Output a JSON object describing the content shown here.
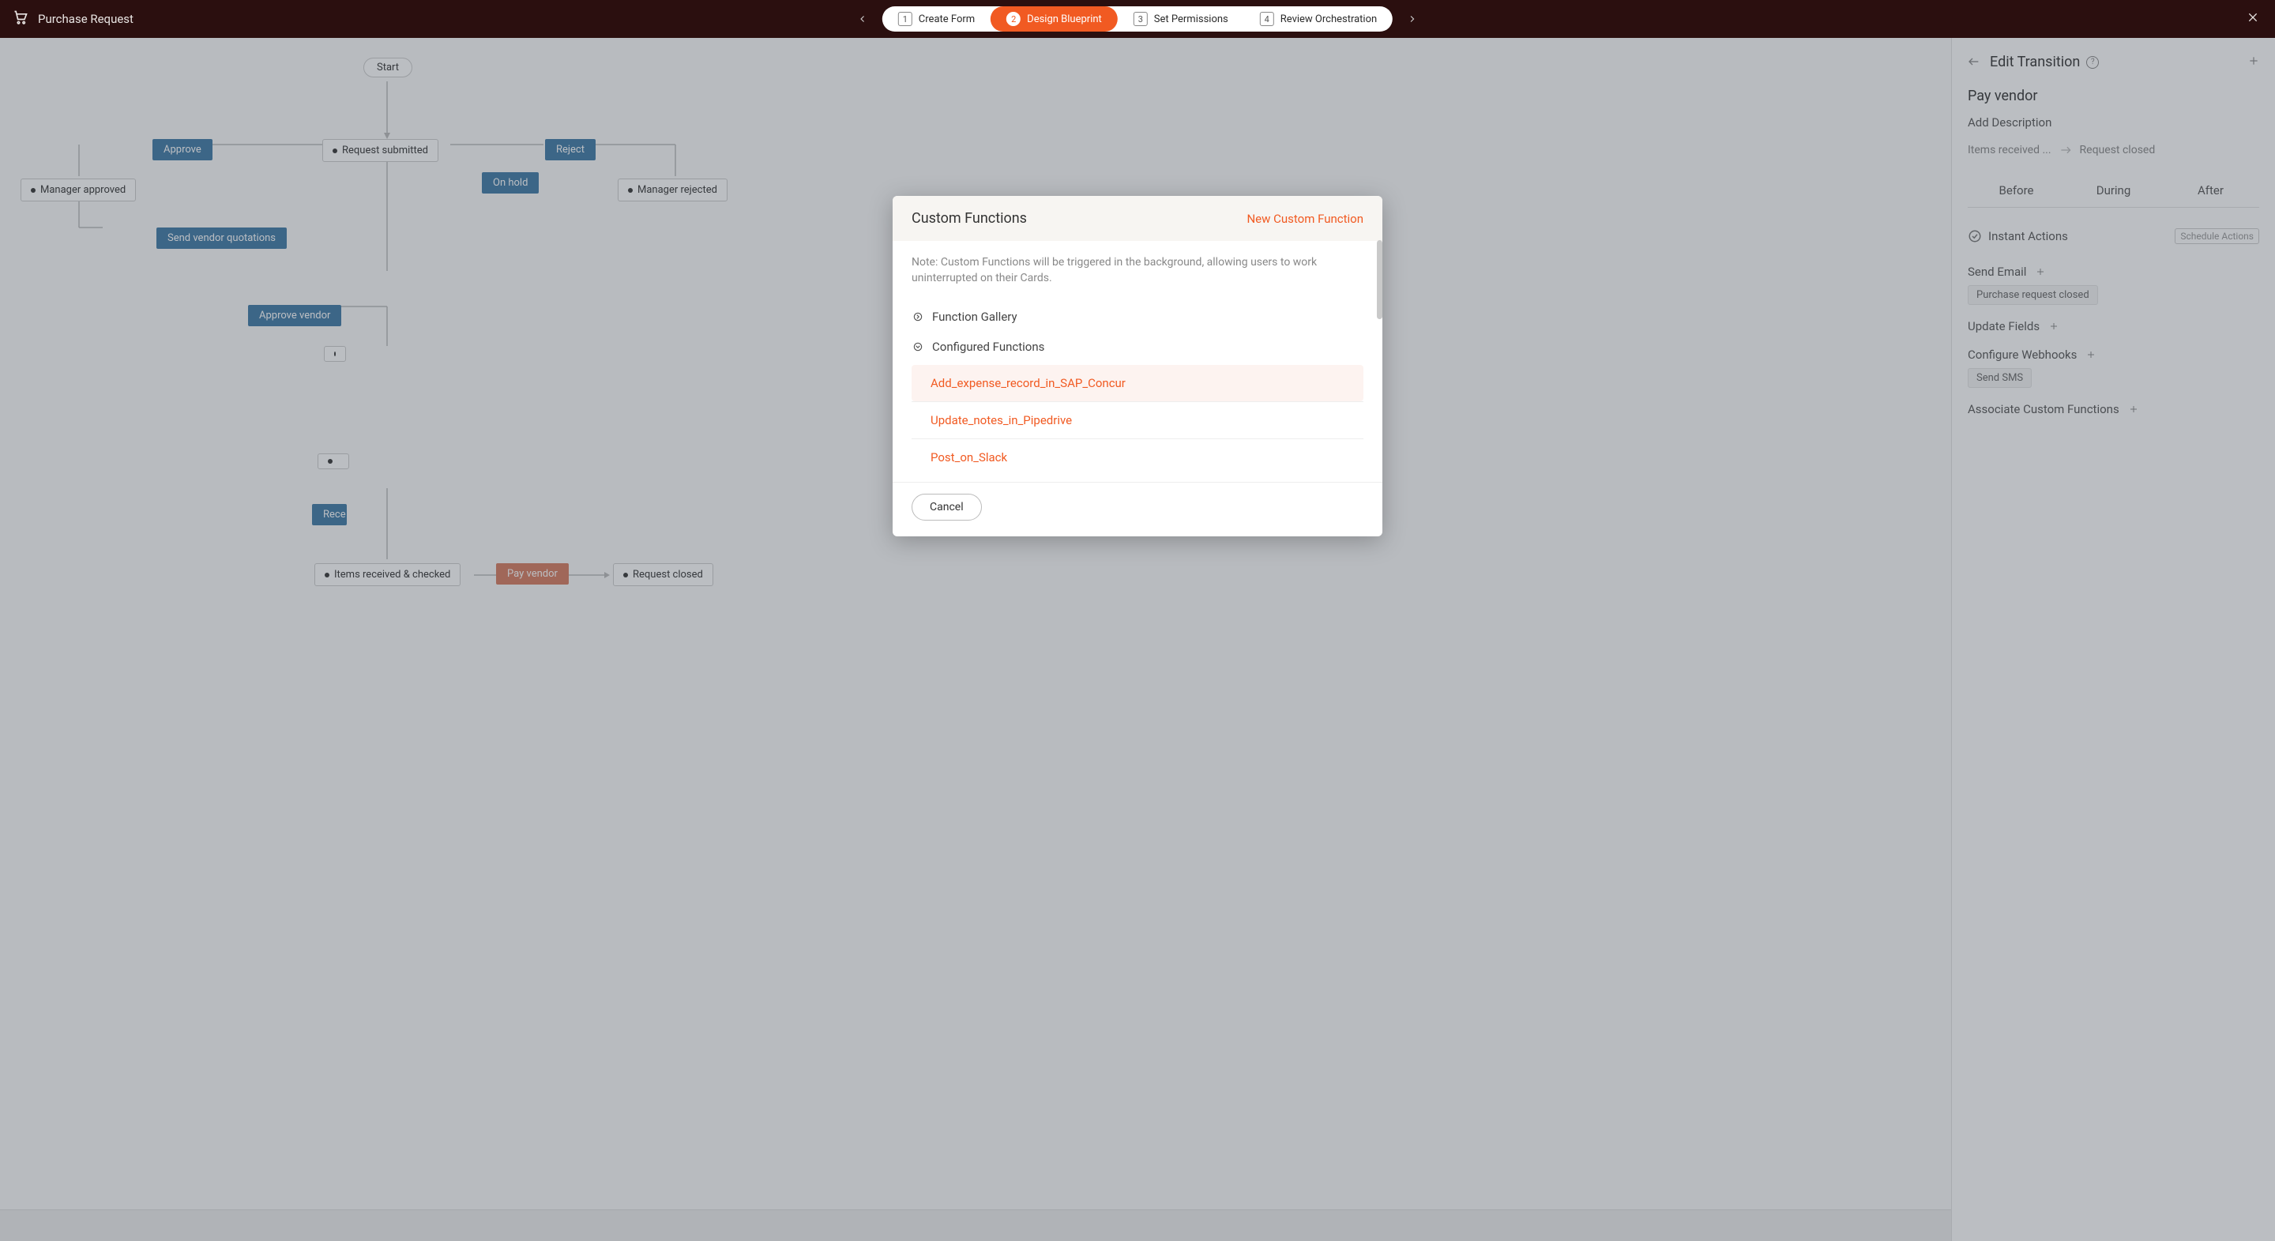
{
  "header": {
    "title": "Purchase Request",
    "steps": [
      {
        "num": "1",
        "label": "Create Form"
      },
      {
        "num": "2",
        "label": "Design Blueprint"
      },
      {
        "num": "3",
        "label": "Set Permissions"
      },
      {
        "num": "4",
        "label": "Review Orchestration"
      }
    ]
  },
  "blueprint": {
    "start": "Start",
    "stages": {
      "request_submitted": "Request submitted",
      "manager_approved": "Manager approved",
      "manager_rejected": "Manager rejected",
      "items_received_checked": "Items received & checked",
      "request_closed": "Request closed"
    },
    "transitions": {
      "approve": "Approve",
      "reject": "Reject",
      "on_hold": "On hold",
      "send_vendor_quotations": "Send vendor quotations",
      "approve_vendor": "Approve vendor",
      "receive": "Rece",
      "pay_vendor": "Pay vendor"
    }
  },
  "panel": {
    "header": "Edit Transition",
    "transition_name": "Pay vendor",
    "add_description": "Add Description",
    "from_stage": "Items received ...",
    "to_stage": "Request closed",
    "tabs": [
      "Before",
      "During",
      "After"
    ],
    "instant_actions": "Instant Actions",
    "schedule_actions": "Schedule Actions",
    "send_email": "Send Email",
    "send_email_chip": "Purchase request closed",
    "update_fields": "Update Fields",
    "configure_webhooks": "Configure Webhooks",
    "webhook_chip": "Send SMS",
    "associate_fn": "Associate Custom Functions"
  },
  "modal": {
    "title": "Custom Functions",
    "new_label": "New Custom Function",
    "note": "Note: Custom Functions will be triggered in the background, allowing users to work uninterrupted on their Cards.",
    "gallery_label": "Function Gallery",
    "configured_label": "Configured Functions",
    "functions": [
      "Add_expense_record_in_SAP_Concur",
      "Update_notes_in_Pipedrive",
      "Post_on_Slack"
    ],
    "cancel": "Cancel"
  }
}
